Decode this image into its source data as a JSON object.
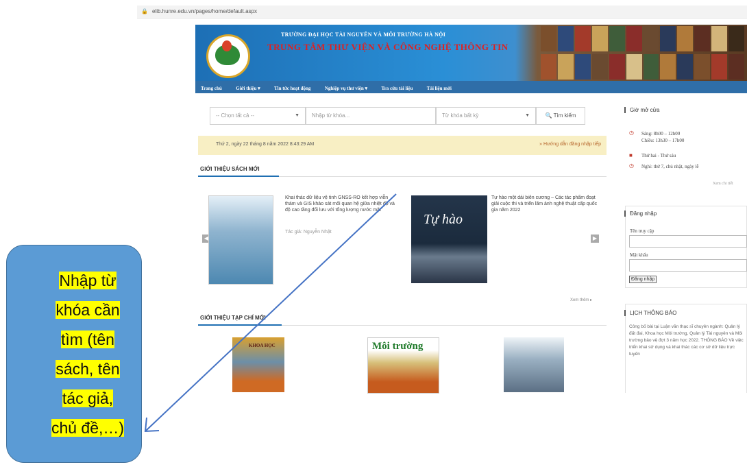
{
  "browser": {
    "url": "elib.hunre.edu.vn/pages/home/default.aspx"
  },
  "banner": {
    "university": "TRƯỜNG ĐẠI HỌC TÀI NGUYÊN VÀ MÔI TRƯỜNG HÀ NỘI",
    "center": "TRUNG TÂM THƯ VIỆN VÀ CÔNG NGHỆ THÔNG TIN",
    "logo_text": "HUNRE"
  },
  "nav": {
    "items": [
      "Trang chủ",
      "Giới thiệu ▾",
      "Tin tức hoạt động",
      "Nghiệp vụ thư viện ▾",
      "Tra cứu tài liệu",
      "Tài liệu mới"
    ]
  },
  "search": {
    "category": "-- Chọn tất cả --",
    "keyword_placeholder": "Nhập từ khóa...",
    "mode": "Từ khóa bất kỳ",
    "button": "Tìm kiếm"
  },
  "info_bar": {
    "date": "Thứ 2, ngày 22 tháng 8 năm 2022 8:43:29 AM",
    "help": "» Hướng dẫn đăng nhập tiếp"
  },
  "new_books": {
    "title": "GIỚI THIỆU SÁCH MỚI",
    "items": [
      {
        "blurb": "Khai thác dữ liệu vệ tinh GNSS-RO kết hợp viễn thám và GIS khảo sát mối quan hệ giữa nhiệt độ và độ cao tầng đối lưu với tổng lượng nước mặt",
        "author": "Tác giả: Nguyễn Nhật"
      },
      {
        "blurb": "Tự hào một dải biên cương – Các tác phẩm đoạt giải cuộc thi và triển lãm ảnh nghệ thuật cấp quốc gia năm 2022",
        "author": "",
        "cover_title": "Tự hào"
      }
    ],
    "more": "Xem thêm ▸"
  },
  "new_journals": {
    "title": "GIỚI THIỆU TẠP CHÍ MỚI",
    "items": [
      {
        "cover_title": "KHOA HỌC"
      },
      {
        "cover_title": "Môi trường"
      },
      {
        "cover_title": ""
      }
    ]
  },
  "sidebar": {
    "hours_title": "Giờ mở cửa",
    "hours": [
      "Sáng: 8h00 – 12h00",
      "Chiều: 13h30 – 17h00",
      "Thứ hai - Thứ sáu",
      "Nghỉ: thứ 7, chủ nhật, ngày lễ"
    ],
    "hours_more": "Xem chi tiết",
    "login_title": "Đăng nhập",
    "username_label": "Tên truy cập",
    "password_label": "Mật khẩu",
    "login_button": "Đăng nhập",
    "notice_title": "LỊCH THÔNG BÁO",
    "notices": "Công bố bài tại Luận văn thạc sĩ chuyên ngành: Quản lý đất đai, Khoa học Môi trường, Quản lý Tài nguyên và Môi trường bảo vệ đợt 3 năm học 2022. THÔNG BÁO Về việc triển khai sử dụng và khai thác các cơ sở dữ liệu trực tuyến"
  },
  "callout": {
    "lines": [
      "Nhập từ",
      "khóa cần",
      "tìm (tên",
      "sách, tên",
      "tác giả,",
      "chủ đề,…)"
    ]
  },
  "colors": {
    "banner_blue": "#1d6fb5",
    "nav_blue": "#2f6ea8",
    "title_red": "#e02020",
    "callout_blue": "#5b9bd5",
    "highlight_yellow": "#ffff00",
    "arrow_blue": "#4472c4"
  }
}
